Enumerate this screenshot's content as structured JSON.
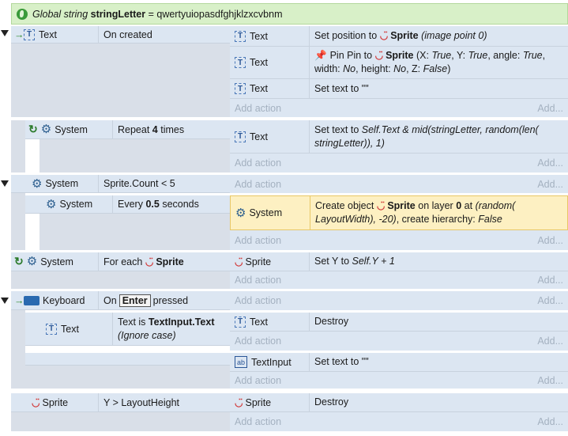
{
  "global_var": {
    "prefix": "Global string",
    "name": "stringLetter",
    "equals": " = ",
    "value": "qwertyuiopasdfghjklzxcvbnm"
  },
  "events": [
    {
      "cond_object": "Text",
      "cond_text": "On created",
      "actions": [
        {
          "object": "Text",
          "parts": [
            "Set position to",
            "Sprite",
            "(image point 0)"
          ]
        },
        {
          "object": "Text",
          "parts": [
            "Pin Pin to",
            "Sprite",
            "(X:",
            "True",
            ", Y:",
            "True",
            ", angle:",
            "True",
            ", width:",
            "No",
            ", height:",
            "No",
            ", Z:",
            "False",
            ")"
          ]
        },
        {
          "object": "Text",
          "parts": [
            "Set text to \"\""
          ]
        }
      ]
    },
    {
      "cond_object": "System",
      "cond_parts": [
        "Repeat",
        "4",
        "times"
      ],
      "actions": [
        {
          "object": "Text",
          "parts": [
            "Set text to",
            "Self.Text & mid(stringLetter, random(len(",
            "stringLetter)), 1)"
          ]
        }
      ]
    },
    {
      "cond_object": "System",
      "cond_text": "Sprite.Count < 5"
    },
    {
      "cond_object": "System",
      "cond_parts": [
        "Every",
        "0.5",
        "seconds"
      ],
      "actions": [
        {
          "object": "System",
          "parts": [
            "Create object",
            "Sprite",
            "on layer",
            "0",
            "at",
            "(random(",
            "LayoutWidth), -20)",
            ", create hierarchy:",
            "False"
          ]
        }
      ]
    },
    {
      "cond_object": "System",
      "cond_parts": [
        "For each",
        "Sprite"
      ],
      "actions": [
        {
          "object": "Sprite",
          "parts": [
            "Set Y to",
            "Self.Y + 1"
          ]
        }
      ]
    },
    {
      "cond_object": "Keyboard",
      "cond_parts": [
        "On",
        "Enter",
        "pressed"
      ]
    },
    {
      "cond_object": "Text",
      "cond_parts": [
        "Text is",
        "TextInput.Text",
        "(Ignore case)"
      ],
      "actions": [
        {
          "object": "Text",
          "parts": [
            "Destroy"
          ]
        }
      ]
    },
    {
      "actions": [
        {
          "object": "TextInput",
          "parts": [
            "Set text to \"\""
          ]
        }
      ]
    },
    {
      "cond_object": "Sprite",
      "cond_text": "Y > LayoutHeight",
      "actions": [
        {
          "object": "Sprite",
          "parts": [
            "Destroy"
          ]
        }
      ]
    }
  ],
  "add_action": "Add action",
  "add_short": "Add...",
  "colors": {
    "event_bg": "#dce6f2",
    "highlight": "#fdf0c2",
    "global_bg": "#d8f0c8"
  }
}
